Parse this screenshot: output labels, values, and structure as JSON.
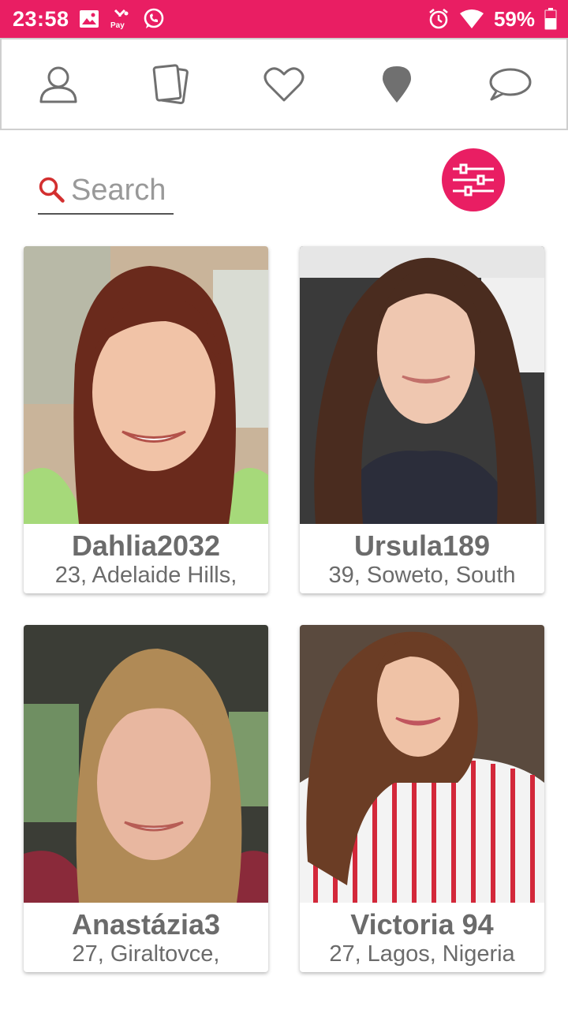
{
  "status_bar": {
    "time": "23:58",
    "battery_percent": "59%",
    "icons_left": [
      "image-icon",
      "caixa-pay-icon",
      "whatsapp-icon"
    ],
    "icons_right": [
      "alarm-icon",
      "wifi-icon",
      "battery-icon"
    ],
    "pay_label": "Pay"
  },
  "colors": {
    "accent": "#e91e63",
    "nav_icon": "#707070",
    "text": "#6b6b6b"
  },
  "nav": {
    "items": [
      {
        "icon": "profile-icon",
        "active": false
      },
      {
        "icon": "cards-icon",
        "active": false
      },
      {
        "icon": "heart-icon",
        "active": false
      },
      {
        "icon": "location-pin-icon",
        "active": true
      },
      {
        "icon": "chat-icon",
        "active": false
      }
    ]
  },
  "search": {
    "placeholder": "Search",
    "value": ""
  },
  "filter": {
    "icon": "filter-sliders-icon"
  },
  "profiles": [
    {
      "name": "Dahlia2032",
      "location": "23, Adelaide Hills,"
    },
    {
      "name": "Ursula189",
      "location": "39, Soweto, South"
    },
    {
      "name": "Anastázia3",
      "location": "27, Giraltovce,"
    },
    {
      "name": "Victoria 94",
      "location": "27, Lagos, Nigeria"
    }
  ]
}
